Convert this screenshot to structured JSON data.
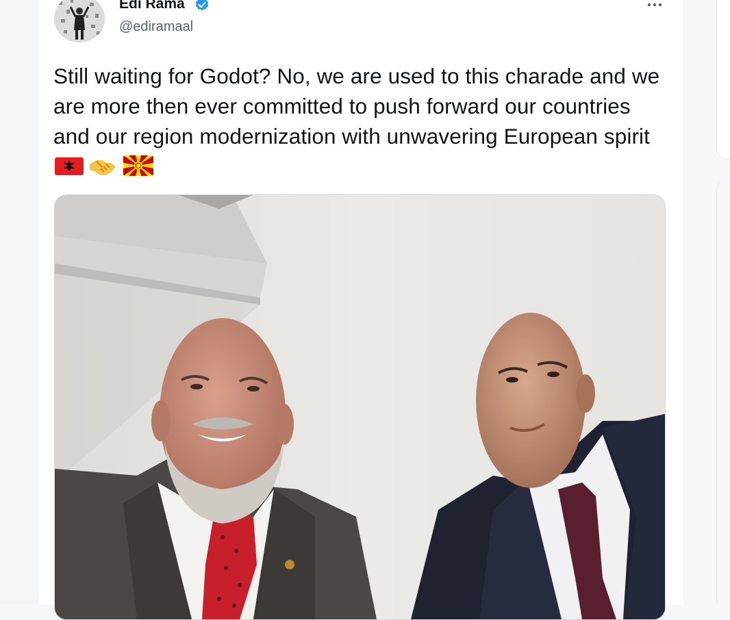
{
  "tweet": {
    "author": {
      "display_name": "Edi Rama",
      "handle": "@ediramaal",
      "verified": true,
      "verified_icon": "verified-badge-icon",
      "accent_color": "#1d9bf0"
    },
    "more_icon": "more-dots-icon",
    "text": "Still waiting for Godot? No, we are used to this charade and we are more then ever committed to push forward our countries and our region modernization with unwavering European spirit",
    "emojis": [
      "albania-flag-emoji",
      "handshake-emoji",
      "north-macedonia-flag-emoji"
    ],
    "media": {
      "type": "photo",
      "subject": "selfie-photo"
    }
  }
}
